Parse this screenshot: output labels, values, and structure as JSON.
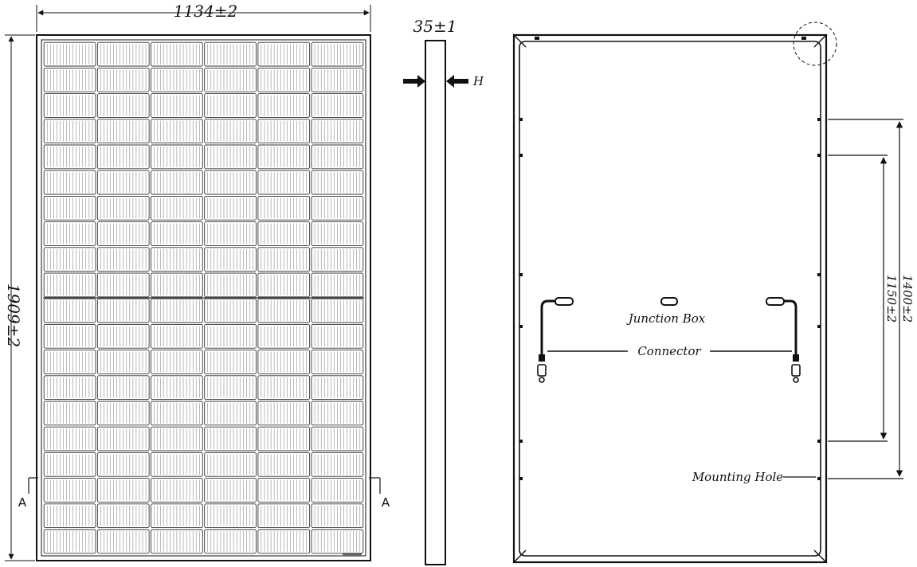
{
  "front_view": {
    "width_label": "1134±2",
    "height_label": "1909±2",
    "section_left": "A",
    "section_right": "A"
  },
  "side_view": {
    "thickness_label": "35±1",
    "h_label": "H"
  },
  "back_view": {
    "junction_box_label": "Junction Box",
    "connector_label": "Connector",
    "mounting_hole_label": "Mounting Hole",
    "dim_inner_label": "1150±2",
    "dim_outer_label": "1400±2"
  }
}
